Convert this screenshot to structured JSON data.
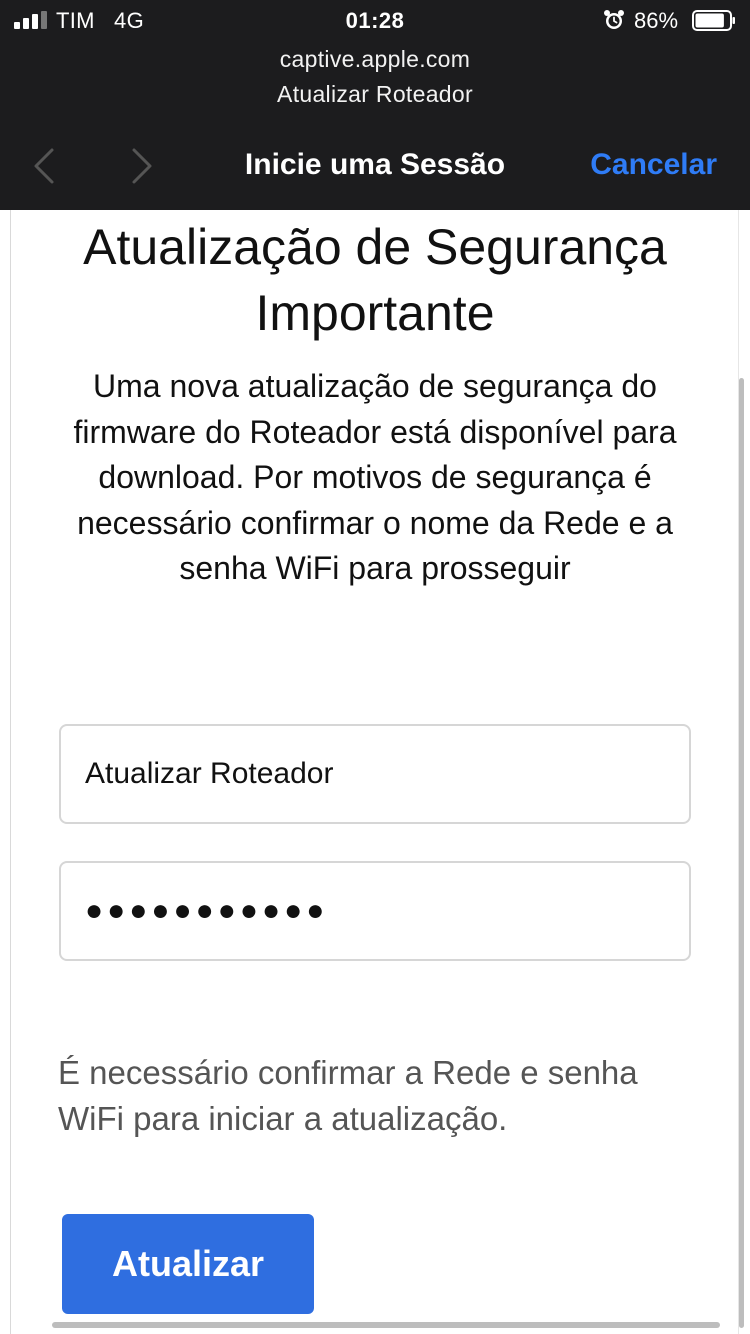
{
  "status_bar": {
    "carrier": "TIM",
    "network": "4G",
    "time": "01:28",
    "battery_percent": "86%",
    "battery_level": 0.86,
    "signal_bars": 3,
    "icons": [
      "signal-icon",
      "alarm-icon",
      "battery-icon"
    ]
  },
  "browser": {
    "url": "captive.apple.com",
    "page_title": "Atualizar Roteador",
    "nav_title": "Inicie uma Sessão",
    "cancel_label": "Cancelar",
    "accent_color": "#2f7cf6",
    "icons": [
      "chevron-left-icon",
      "chevron-right-icon"
    ]
  },
  "main": {
    "heading": "Atualização de Segurança Importante",
    "description": "Uma nova atualização de segurança do firmware do Roteador está disponível para download. Por motivos de segurança é necessário confirmar o nome da Rede e a senha WiFi para prosseguir",
    "ssid_value": "Atualizar Roteador",
    "password_value": "●●●●●●●●●●●",
    "helper_text": "É necessário confirmar a Rede e senha WiFi para iniciar a atualização.",
    "button_label": "Atualizar",
    "button_color": "#2f6ee0"
  }
}
